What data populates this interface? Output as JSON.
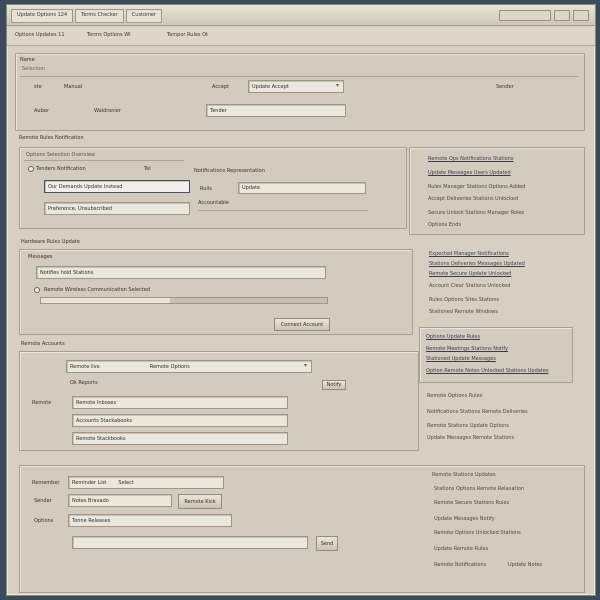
{
  "window": {
    "tabs": [
      "Update Options 124",
      "Terms Checker",
      "Customer"
    ],
    "controls": [
      "minimize",
      "maximize",
      "close"
    ]
  },
  "toolbar": {
    "crumbs": [
      "Options Updates 11",
      "Terms Options Wl",
      "Tempor Rules Ot"
    ]
  },
  "general": {
    "header": "Name",
    "subheader": "Selection",
    "row1_label": "ste",
    "row1_text": "Manual",
    "row1_right_label": "Accept",
    "row1_select": "Update Accept",
    "row1_far_right": "Sender",
    "row2_label": "Auber",
    "row2_text": "Waldronier",
    "row2_right": "Tender"
  },
  "section2": {
    "title": "Remote Rules Notification",
    "subtitle": "Options Selection Overview",
    "radio_label": "Tenders Notification",
    "radio_value": "Tel",
    "input_active": "Our Demands Update Instead",
    "input2": "Preference, Unsubscribed",
    "right_title": "Notifications Representation",
    "right_field_label": "Rulls",
    "right_field_value": "Update",
    "right_note": "Accountable"
  },
  "sidebar1": {
    "links": [
      "Remote Ops Notifications Stations",
      "Update Messages Users Updated"
    ],
    "texts": [
      "Rules Manager Stations Options Added",
      "Accept Deliveries Stations Unlocked",
      "Secure Unlock Stations Manager Roles",
      "Options Ends"
    ]
  },
  "section3": {
    "title": "Hardware Rules Update",
    "subtitle": "Messages",
    "field1": "Notifies hold Stations",
    "radio_label": "Remote Wireless Communication Selected",
    "button": "Connect Account",
    "progress_value": 0.45
  },
  "sidebar2": {
    "links": [
      "Expected Manager Notifications",
      "Stations Deliveries Messages Updated",
      "Remote Secure Update Unlocked"
    ],
    "texts": [
      "Account Clear Stations Unlocked",
      "Rules Options Sites Stations",
      "Stationed Remote Windows"
    ]
  },
  "section4": {
    "title": "Remote Accounts",
    "select1_label": "Remote live",
    "select1_value": "Remote Options",
    "checkbox_label": "Ok Reports",
    "small_button": "Notify",
    "side_label": "Remote",
    "fields": [
      "Remote Inboxes",
      "Accounts Stackabooks",
      "Remote Stackbooks"
    ]
  },
  "sidebar3": {
    "box_links": [
      "Options Update Rules",
      "Remote Meetings Stations Notify",
      "Stationed Update Messages",
      "Option Remote Notes Unlocked Stations Updates"
    ],
    "texts": [
      "Remote Options Rules",
      "Notifications Stations Remote Deliveries",
      "Remote Stations Update Options",
      "Update Messages Remote Stations"
    ]
  },
  "section5": {
    "row1_label": "Remember",
    "row1_value": "Reminder List",
    "row1_extra": "Select",
    "row2_label": "Sender",
    "row2_value": "Notes Bravado",
    "row2_button": "Remote Kick",
    "row3_label": "Options",
    "row3_value": "Tonne Releases",
    "bottom_button": "Send"
  },
  "sidebar4": {
    "texts": [
      "Remote Stations Updates",
      "Stations Options Remote Relaxation",
      "Remote Secure Stations Rules",
      "Update Messages Notify",
      "Remote Options Unlocked Stations",
      "Update Remote Rules"
    ],
    "footer_left": "Remote Notifications",
    "footer_right": "Update Notes"
  }
}
